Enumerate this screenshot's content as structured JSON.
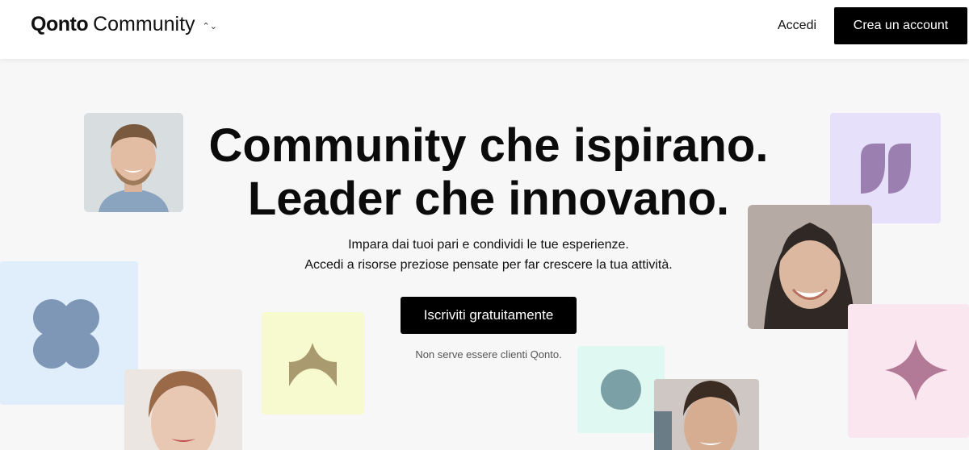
{
  "header": {
    "brand_logo": "Qonto",
    "brand_name": "Community",
    "brand_chevron": "⌃⌄",
    "login_label": "Accedi",
    "signup_label": "Crea un account"
  },
  "hero": {
    "title_line1": "Community che ispirano.",
    "title_line2": "Leader che innovano.",
    "subtitle_line1": "Impara dai tuoi pari e condividi le tue esperienze.",
    "subtitle_line2": "Accedi a risorse preziose pensate per far crescere la tua attività.",
    "cta_label": "Iscriviti gratuitamente",
    "note": "Non serve essere clienti Qonto."
  },
  "decorations": [
    {
      "name": "quote-icon",
      "tile_color": "#e7e0fb",
      "shape_color": "#9a7fb0"
    },
    {
      "name": "clover-icon",
      "tile_color": "#dfeefa",
      "shape_color": "#7f97b6"
    },
    {
      "name": "arch-icon",
      "tile_color": "#f7f9cf",
      "shape_color": "#a99a70"
    },
    {
      "name": "circle-icon",
      "tile_color": "#dff8f2",
      "shape_color": "#7ba0a6"
    },
    {
      "name": "sparkle-icon",
      "tile_color": "#fae6ef",
      "shape_color": "#b27a96"
    }
  ],
  "colors": {
    "background": "#f7f7f7",
    "primary_button": "#000000"
  }
}
